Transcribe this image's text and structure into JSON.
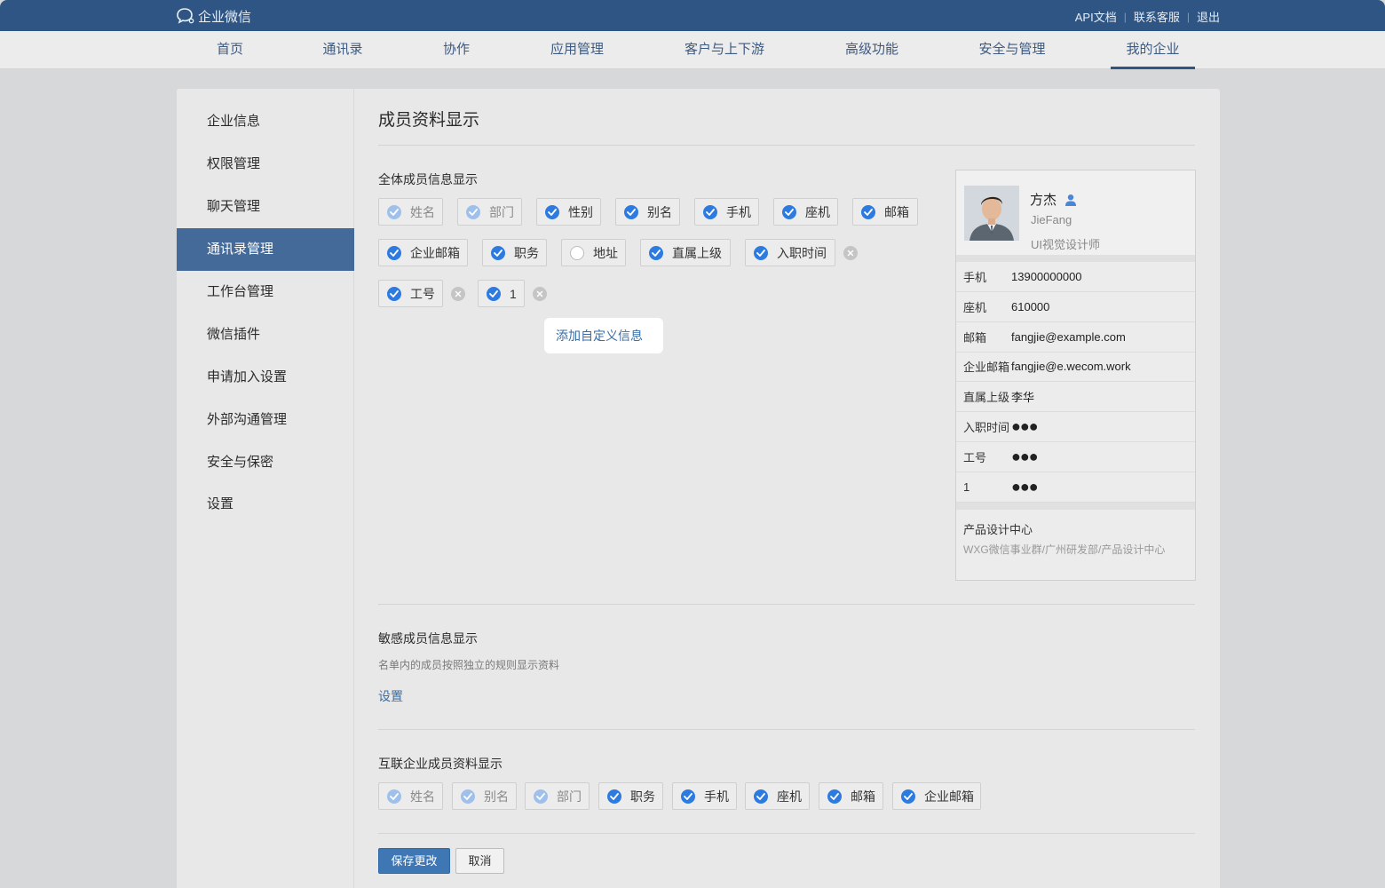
{
  "app": {
    "logo_text": "企业微信"
  },
  "top_links": {
    "api_docs": "API文档",
    "contact_support": "联系客服",
    "logout": "退出",
    "sep": "|"
  },
  "nav": {
    "items": [
      "首页",
      "通讯录",
      "协作",
      "应用管理",
      "客户与上下游",
      "高级功能",
      "安全与管理",
      "我的企业"
    ],
    "active": "我的企业"
  },
  "sidebar": {
    "items": [
      "企业信息",
      "权限管理",
      "聊天管理",
      "通讯录管理",
      "工作台管理",
      "微信插件",
      "申请加入设置",
      "外部沟通管理",
      "安全与保密",
      "设置"
    ],
    "active": "通讯录管理"
  },
  "page": {
    "title": "成员资料显示"
  },
  "all_members": {
    "title": "全体成员信息显示",
    "fields": [
      {
        "label": "姓名",
        "state": "locked"
      },
      {
        "label": "部门",
        "state": "locked"
      },
      {
        "label": "性别",
        "state": "checked"
      },
      {
        "label": "别名",
        "state": "checked"
      },
      {
        "label": "手机",
        "state": "checked"
      },
      {
        "label": "座机",
        "state": "checked"
      },
      {
        "label": "邮箱",
        "state": "checked"
      },
      {
        "label": "企业邮箱",
        "state": "checked"
      },
      {
        "label": "职务",
        "state": "checked"
      },
      {
        "label": "地址",
        "state": "unchecked"
      },
      {
        "label": "直属上级",
        "state": "checked"
      },
      {
        "label": "入职时间",
        "state": "checked"
      },
      {
        "label": "工号",
        "state": "checked"
      },
      {
        "label": "1",
        "state": "checked"
      }
    ],
    "add_custom": "添加自定义信息"
  },
  "preview_card": {
    "name": "方杰",
    "alias": "JieFang",
    "position": "UI视觉设计师",
    "rows": [
      {
        "key": "手机",
        "value": "13900000000"
      },
      {
        "key": "座机",
        "value": "610000"
      },
      {
        "key": "邮箱",
        "value": "fangjie@example.com"
      },
      {
        "key": "企业邮箱",
        "value": "fangjie@e.wecom.work"
      },
      {
        "key": "直属上级",
        "value": "李华"
      },
      {
        "key": "入职时间",
        "value": "●●●"
      },
      {
        "key": "工号",
        "value": "●●●"
      },
      {
        "key": "1",
        "value": "●●●"
      }
    ],
    "department": "产品设计中心",
    "department_path": "WXG微信事业群/广州研发部/产品设计中心"
  },
  "sensitive": {
    "title": "敏感成员信息显示",
    "desc": "名单内的成员按照独立的规则显示资料",
    "link": "设置"
  },
  "interconnected": {
    "title": "互联企业成员资料显示",
    "fields": [
      {
        "label": "姓名",
        "state": "locked"
      },
      {
        "label": "别名",
        "state": "locked"
      },
      {
        "label": "部门",
        "state": "locked"
      },
      {
        "label": "职务",
        "state": "checked"
      },
      {
        "label": "手机",
        "state": "checked"
      },
      {
        "label": "座机",
        "state": "checked"
      },
      {
        "label": "邮箱",
        "state": "checked"
      },
      {
        "label": "企业邮箱",
        "state": "checked"
      }
    ]
  },
  "actions": {
    "save": "保存更改",
    "cancel": "取消"
  },
  "colors": {
    "topbar": "#2e5583",
    "accent": "#2d7be0",
    "sidebar_active": "#446a9a",
    "link": "#3a6ea5"
  }
}
